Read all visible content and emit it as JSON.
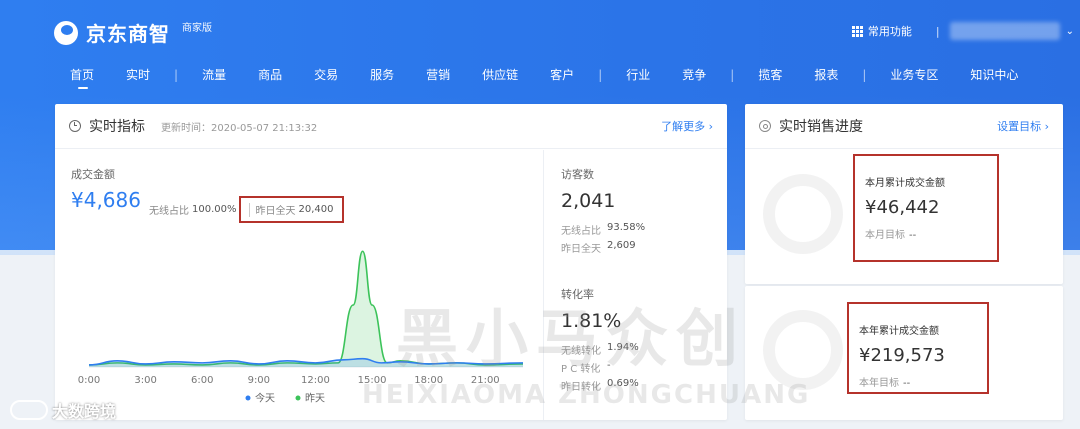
{
  "brand": {
    "name": "京东商智",
    "edition": "商家版"
  },
  "topbar": {
    "common_functions": "常用功能",
    "separator": "|"
  },
  "nav": {
    "items": [
      "首页",
      "实时",
      "流量",
      "商品",
      "交易",
      "服务",
      "营销",
      "供应链",
      "客户",
      "行业",
      "竞争",
      "揽客",
      "报表",
      "业务专区",
      "知识中心"
    ],
    "active": "首页"
  },
  "realtime": {
    "title": "实时指标",
    "update_label": "更新时间：2020-05-07 21:13:32",
    "more_link": "了解更多 ›",
    "gmv_label": "成交金额",
    "gmv_value": "¥4,686",
    "wireless_label": "无线占比",
    "wireless_value": "100.00%",
    "yesterday_label": "昨日全天",
    "yesterday_value": "20,400"
  },
  "visitors": {
    "label": "访客数",
    "value": "2,041",
    "wireless_label": "无线占比",
    "wireless_value": "93.58%",
    "yesterday_label": "昨日全天",
    "yesterday_value": "2,609"
  },
  "conversion": {
    "label": "转化率",
    "value": "1.81%",
    "wireless_label": "无线转化",
    "wireless_value": "1.94%",
    "pc_label": "P C 转化",
    "pc_value": "-",
    "yesterday_label": "昨日转化",
    "yesterday_value": "0.69%"
  },
  "chart_data": {
    "type": "line",
    "x": [
      "0:00",
      "3:00",
      "6:00",
      "9:00",
      "12:00",
      "15:00",
      "18:00",
      "21:00"
    ],
    "series": [
      {
        "name": "今天",
        "color": "#2f7ef0",
        "points": [
          [
            0,
            2
          ],
          [
            1.5,
            6
          ],
          [
            3,
            3
          ],
          [
            4.5,
            5
          ],
          [
            6,
            4
          ],
          [
            7.5,
            6
          ],
          [
            9,
            3
          ],
          [
            10.5,
            6
          ],
          [
            12,
            4
          ],
          [
            13.5,
            7
          ],
          [
            14.5,
            8
          ],
          [
            15.5,
            4
          ],
          [
            16.5,
            5
          ],
          [
            18,
            3
          ],
          [
            19.5,
            4
          ],
          [
            21,
            3
          ],
          [
            23,
            4
          ]
        ]
      },
      {
        "name": "昨天",
        "color": "#3cc35a",
        "points": [
          [
            0,
            2
          ],
          [
            1.5,
            4
          ],
          [
            3,
            2
          ],
          [
            4.5,
            3
          ],
          [
            6,
            2
          ],
          [
            7.5,
            4
          ],
          [
            9,
            2
          ],
          [
            10.5,
            4
          ],
          [
            12,
            3
          ],
          [
            13.2,
            4
          ],
          [
            14.0,
            60
          ],
          [
            14.5,
            112
          ],
          [
            15.0,
            60
          ],
          [
            15.8,
            4
          ],
          [
            16.5,
            6
          ],
          [
            18,
            3
          ],
          [
            19.5,
            4
          ],
          [
            21,
            2
          ],
          [
            23,
            3
          ]
        ]
      }
    ],
    "xlim": [
      0,
      23
    ],
    "ylim": [
      0,
      120
    ],
    "legend": "bottom"
  },
  "sales_progress": {
    "title": "实时销售进度",
    "set_target": "设置目标 ›",
    "month": {
      "label": "本月累计成交金额",
      "value": "¥46,442",
      "goal_label": "本月目标",
      "goal_value": "--"
    },
    "year": {
      "label": "本年累计成交金额",
      "value": "¥219,573",
      "goal_label": "本年目标",
      "goal_value": "--"
    }
  },
  "watermarks": {
    "main": "黑小马众创",
    "sub": "HEIXIAOMA ZHONGCHUANG",
    "corner": "大数跨境"
  }
}
